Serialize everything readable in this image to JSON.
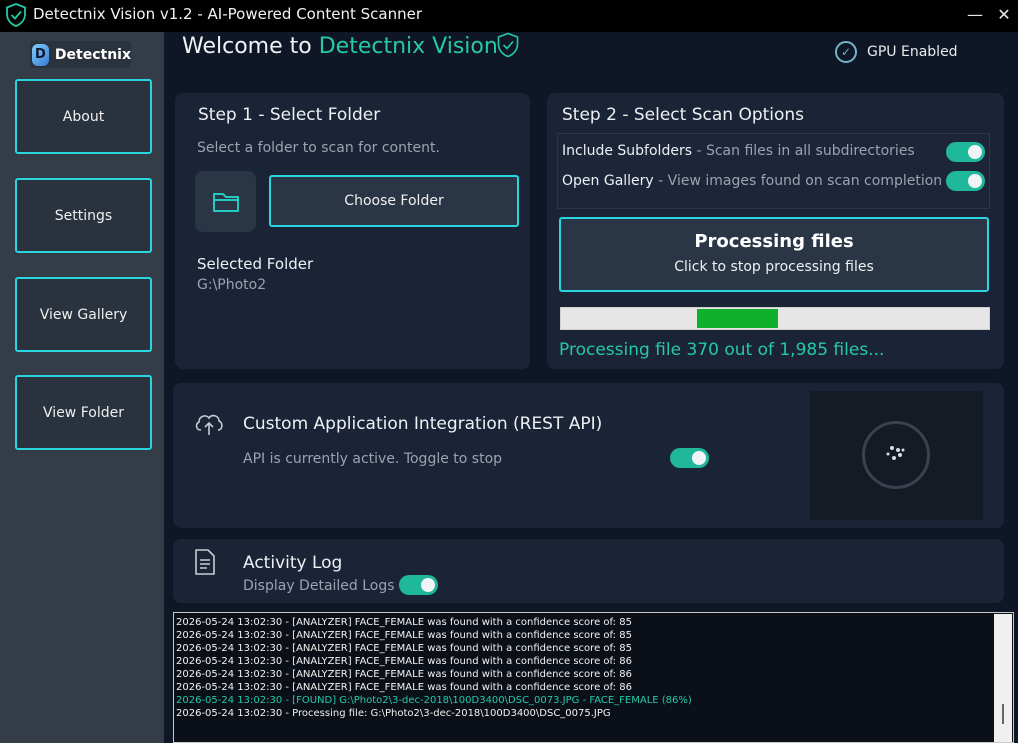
{
  "window": {
    "title": "Detectnix Vision v1.2 - AI-Powered Content Scanner",
    "minimize_glyph": "—",
    "close_glyph": "✕"
  },
  "sidebar": {
    "logo_text": "Detectnix",
    "logo_letter": "D",
    "items": [
      {
        "label": "About"
      },
      {
        "label": "Settings"
      },
      {
        "label": "View Gallery"
      },
      {
        "label": "View Folder"
      }
    ]
  },
  "header": {
    "welcome_prefix": "Welcome to ",
    "welcome_accent": "Detectnix Vision",
    "gpu_label": "GPU Enabled"
  },
  "step1": {
    "title": "Step 1 - Select Folder",
    "subtitle": "Select a folder to scan for content.",
    "choose_label": "Choose Folder",
    "selected_label": "Selected Folder",
    "selected_value": "G:\\Photo2"
  },
  "step2": {
    "title": "Step 2 - Select Scan Options",
    "options": [
      {
        "label": "Include Subfolders",
        "desc": " - Scan files in all subdirectories",
        "on": true
      },
      {
        "label": "Open Gallery",
        "desc": " - View images found on scan completion",
        "on": true
      }
    ],
    "process_title": "Processing files",
    "process_subtitle": "Click to stop processing files",
    "progress_fraction": 0.19,
    "progress_text": "Processing file 370 out of 1,985 files..."
  },
  "api": {
    "title": "Custom Application Integration (REST API)",
    "status": "API is currently active. Toggle to stop",
    "on": true
  },
  "activity": {
    "title": "Activity Log",
    "detailed_label": "Display Detailed Logs",
    "detailed_on": true
  },
  "log": {
    "lines": [
      {
        "text": "2026-05-24 13:02:30 - [ANALYZER] FACE_FEMALE was found with a confidence score of: 85",
        "found": false
      },
      {
        "text": "2026-05-24 13:02:30 - [ANALYZER] FACE_FEMALE was found with a confidence score of: 85",
        "found": false
      },
      {
        "text": "2026-05-24 13:02:30 - [ANALYZER] FACE_FEMALE was found with a confidence score of: 85",
        "found": false
      },
      {
        "text": "2026-05-24 13:02:30 - [ANALYZER] FACE_FEMALE was found with a confidence score of: 86",
        "found": false
      },
      {
        "text": "2026-05-24 13:02:30 - [ANALYZER] FACE_FEMALE was found with a confidence score of: 86",
        "found": false
      },
      {
        "text": "2026-05-24 13:02:30 - [ANALYZER] FACE_FEMALE was found with a confidence score of: 86",
        "found": false
      },
      {
        "text": "2026-05-24 13:02:30 - [FOUND] G:\\Photo2\\3-dec-2018\\100D3400\\DSC_0073.JPG - FACE_FEMALE (86%)",
        "found": true
      },
      {
        "text": "2026-05-24 13:02:30 - Processing file: G:\\Photo2\\3-dec-2018\\100D3400\\DSC_0075.JPG",
        "found": false
      }
    ]
  },
  "colors": {
    "accent": "#25c9a8",
    "button_border": "#27d6df",
    "progress_fill": "#0eb02c",
    "toggle_on": "#1fb89a"
  }
}
